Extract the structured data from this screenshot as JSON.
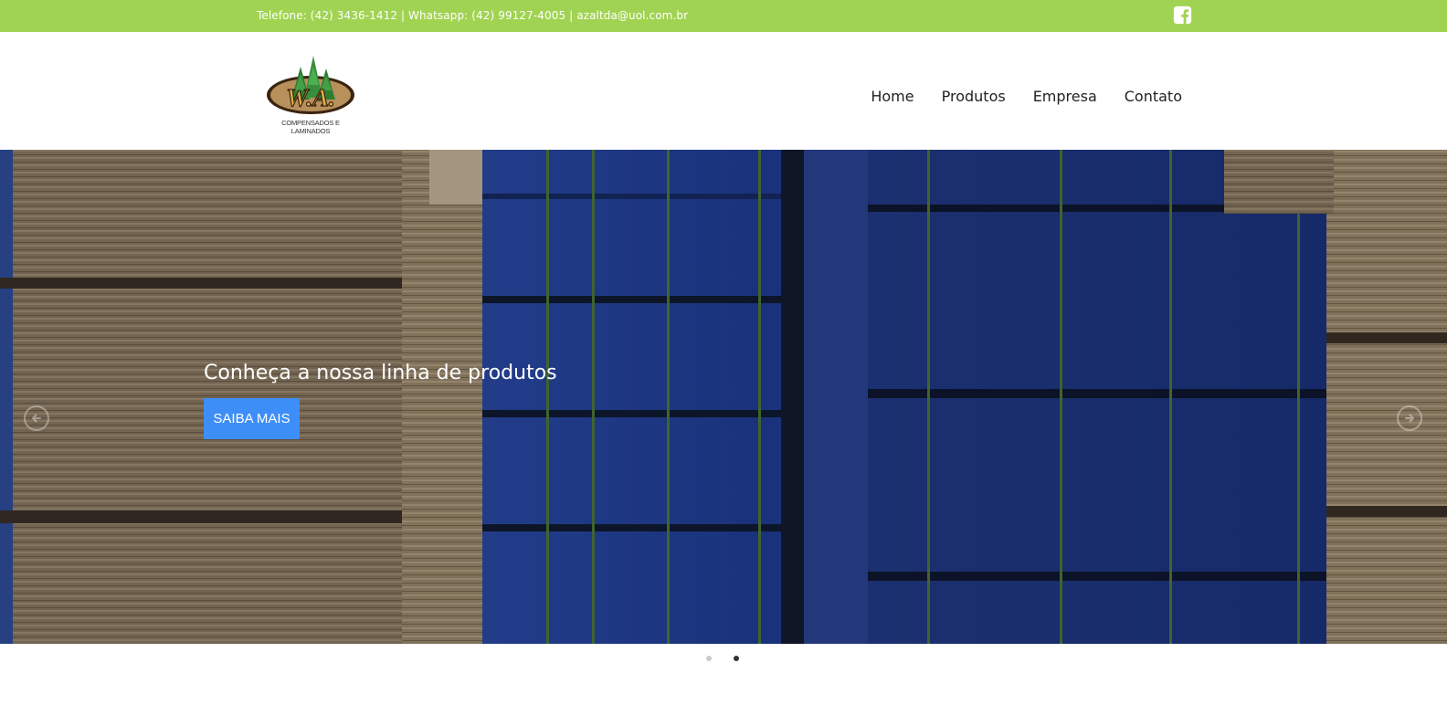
{
  "topbar": {
    "contact_text": "Telefone: (42) 3436-1412 | Whatsapp: (42) 99127-4005 | azaltda@uol.com.br",
    "social_icon": "facebook-square-icon",
    "background_color": "#a1d352"
  },
  "header": {
    "logo": {
      "letters": "W.A.",
      "subtitle": "COMPENSADOS E LAMINADOS"
    },
    "nav": [
      {
        "label": "Home"
      },
      {
        "label": "Produtos"
      },
      {
        "label": "Empresa"
      },
      {
        "label": "Contato"
      }
    ]
  },
  "hero": {
    "heading": "Conheça a nossa linha de produtos",
    "button_label": "SAIBA MAIS",
    "button_color": "#3e8ef7",
    "prev_icon": "arrow-left-circle-icon",
    "next_icon": "arrow-right-circle-icon"
  },
  "carousel": {
    "slide_count": 2,
    "active_slide": 2
  }
}
